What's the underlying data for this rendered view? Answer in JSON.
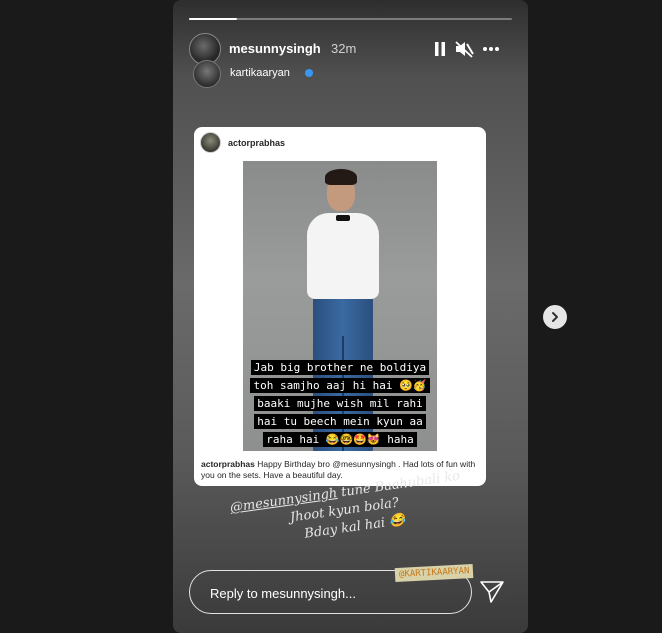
{
  "story": {
    "progress_fraction": 0.15,
    "user": {
      "name": "mesunnysingh",
      "time": "32m"
    },
    "sub_user": {
      "name": "kartikaaryan",
      "verified": true
    },
    "controls": [
      "pause-icon",
      "mute-icon",
      "more-icon"
    ]
  },
  "card": {
    "user": "actorprabhas",
    "photo_caption": [
      "Jab big brother ne boldiya",
      "toh samjho aaj hi hai 🥺🥳",
      "baaki mujhe wish mil rahi",
      "hai tu beech mein kyun aa",
      "raha hai 😂🤓🤩😻 haha"
    ],
    "post_user": "actorprabhas",
    "post_text": "Happy Birthday bro @mesunnysingh . Had lots of fun with you on the sets. Have a beautiful day."
  },
  "handwritten": {
    "mention": "@mesunnysingh",
    "line1_rest": " tune Baahubali ko",
    "line2": "Jhoot kyun bola?",
    "line3": "Bday kal hai 😂"
  },
  "tag_sticker": "@KARTIKAARYAN",
  "reply": {
    "placeholder": "Reply to mesunnysingh..."
  },
  "colors": {
    "verified": "#3897f0",
    "sticker_bg": "#d9d2a8",
    "sticker_text": "#c57a1e"
  }
}
